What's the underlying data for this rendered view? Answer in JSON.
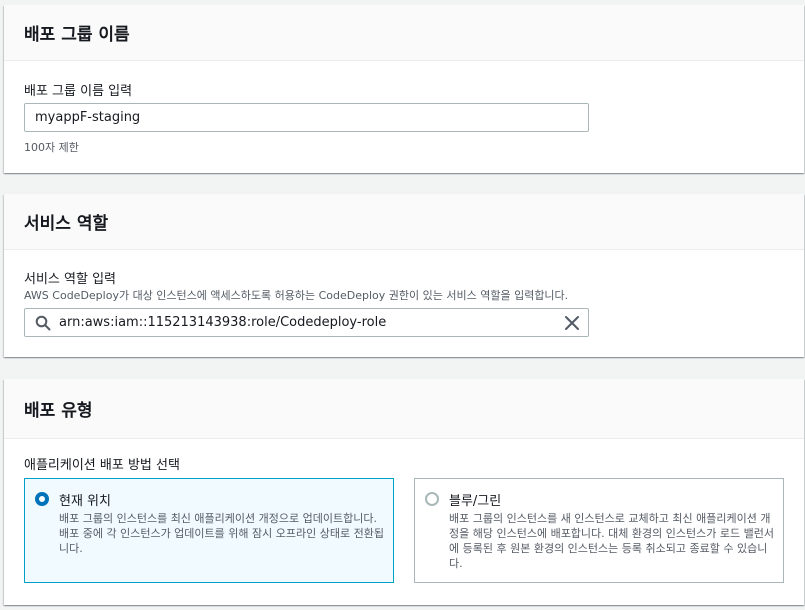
{
  "deployment_group_name": {
    "title": "배포 그룹 이름",
    "input_label": "배포 그룹 이름 입력",
    "input_value": "myappF-staging",
    "constraint": "100자 제한"
  },
  "service_role": {
    "title": "서비스 역할",
    "input_label": "서비스 역할 입력",
    "description": "AWS CodeDeploy가 대상 인스턴스에 액세스하도록 허용하는 CodeDeploy 권한이 있는 서비스 역할을 입력합니다.",
    "input_value": "arn:aws:iam::115213143938:role/Codedeploy-role",
    "search_icon": "search-icon",
    "clear_icon": "close-icon"
  },
  "deployment_type": {
    "title": "배포 유형",
    "choice_label": "애플리케이션 배포 방법 선택",
    "options": [
      {
        "label": "현재 위치",
        "description": "배포 그룹의 인스턴스를 최신 애플리케이션 개정으로 업데이트합니다. 배포 중에 각 인스턴스가 업데이트를 위해 잠시 오프라인 상태로 전환됩니다.",
        "selected": true
      },
      {
        "label": "블루/그린",
        "description": "배포 그룹의 인스턴스를 새 인스턴스로 교체하고 최신 애플리케이션 개정을 해당 인스턴스에 배포합니다. 대체 환경의 인스턴스가 로드 밸런서에 등록된 후 원본 환경의 인스턴스는 등록 취소되고 종료할 수 있습니다.",
        "selected": false
      }
    ]
  },
  "colors": {
    "accent": "#0073bb",
    "selected_border": "#00a1c9",
    "selected_bg": "#f1faff",
    "page_bg": "#f2f3f3"
  }
}
